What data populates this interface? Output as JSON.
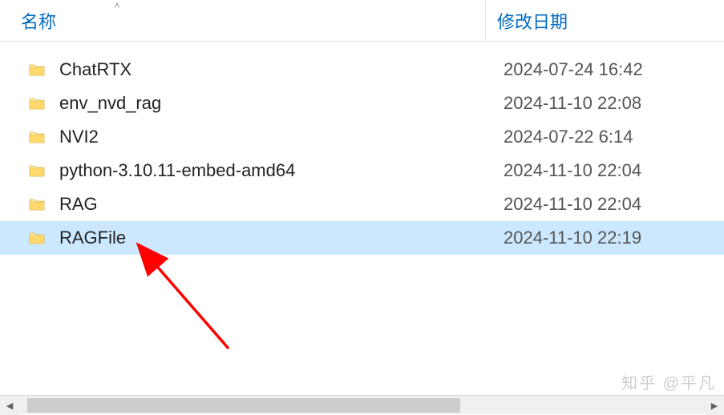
{
  "header": {
    "name_label": "名称",
    "date_label": "修改日期",
    "sort_indicator": "˄"
  },
  "files": [
    {
      "name": "ChatRTX",
      "icon": "folder",
      "modified": "2024-07-24 16:42",
      "selected": false
    },
    {
      "name": "env_nvd_rag",
      "icon": "folder",
      "modified": "2024-11-10 22:08",
      "selected": false
    },
    {
      "name": "NVI2",
      "icon": "folder",
      "modified": "2024-07-22 6:14",
      "selected": false
    },
    {
      "name": "python-3.10.11-embed-amd64",
      "icon": "folder",
      "modified": "2024-11-10 22:04",
      "selected": false
    },
    {
      "name": "RAG",
      "icon": "folder",
      "modified": "2024-11-10 22:04",
      "selected": false
    },
    {
      "name": "RAGFile",
      "icon": "folder",
      "modified": "2024-11-10 22:19",
      "selected": true
    }
  ],
  "watermark": "知乎 @平凡",
  "annotation": {
    "color": "#ff0000"
  },
  "scrollbar": {
    "left_glyph": "◀",
    "right_glyph": "▶"
  }
}
